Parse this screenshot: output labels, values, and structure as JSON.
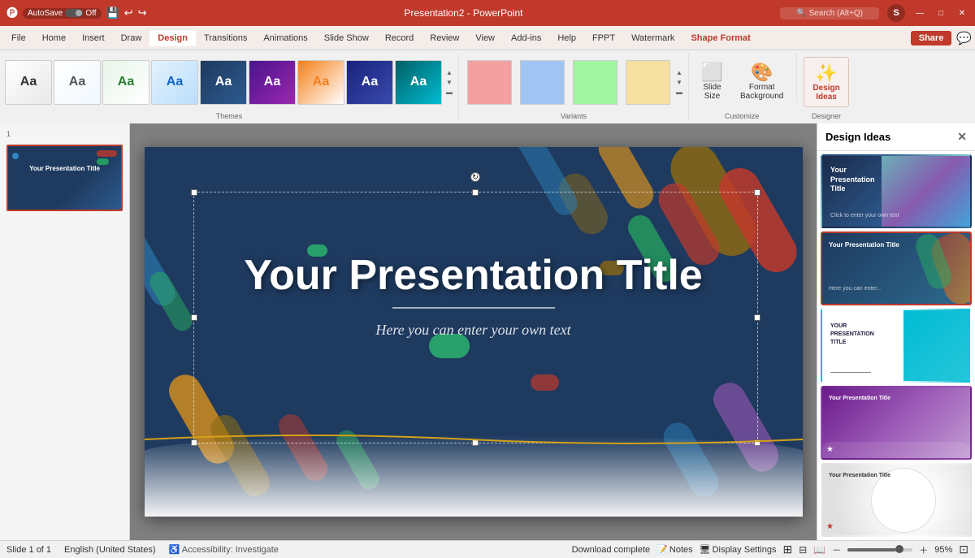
{
  "titlebar": {
    "autosave_label": "AutoSave",
    "autosave_state": "Off",
    "file_name": "Presentation2 - PowerPoint",
    "search_placeholder": "Search (Alt+Q)",
    "user_initials": "S",
    "minimize_label": "—",
    "maximize_label": "□",
    "close_label": "✕"
  },
  "tabs": {
    "items": [
      "File",
      "Home",
      "Insert",
      "Draw",
      "Design",
      "Transitions",
      "Animations",
      "Slide Show",
      "Record",
      "Review",
      "View",
      "Add-ins",
      "Help",
      "FPPT",
      "Watermark",
      "Shape Format"
    ],
    "active": "Design",
    "special": "Shape Format"
  },
  "ribbon": {
    "themes_label": "Themes",
    "variants_label": "Variants",
    "customize_label": "Customize",
    "designer_label": "Designer",
    "slide_size_label": "Slide\nSize",
    "format_background_label": "Format\nBackground",
    "design_ideas_label": "Design\nIdeas",
    "share_label": "Share"
  },
  "themes": [
    {
      "id": "t1",
      "label": "Aa",
      "class": "tc1"
    },
    {
      "id": "t2",
      "label": "Aa",
      "class": "tc2"
    },
    {
      "id": "t3",
      "label": "Aa",
      "class": "tc3"
    },
    {
      "id": "t4",
      "label": "Aa",
      "class": "tc4"
    },
    {
      "id": "t5",
      "label": "Aa",
      "class": "tc5"
    },
    {
      "id": "t6",
      "label": "Aa",
      "class": "tc6"
    },
    {
      "id": "t7",
      "label": "Aa",
      "class": "tc7"
    },
    {
      "id": "t8",
      "label": "Aa",
      "class": "tc8"
    },
    {
      "id": "t9",
      "label": "Aa",
      "class": "tc9"
    }
  ],
  "slide": {
    "number": "1",
    "title": "Your Presentation Title",
    "subtitle": "Here you can enter your own text"
  },
  "design_ideas": {
    "panel_title": "Design Ideas",
    "items": [
      {
        "id": "di1",
        "class": "di-1",
        "title": "Your\nPresentation\nTitle",
        "selected": false
      },
      {
        "id": "di2",
        "class": "di-2",
        "title": "Your Presentation Title",
        "selected": true
      },
      {
        "id": "di3",
        "class": "di-3",
        "title": "YOUR\nPRESENTATION\nTITLE",
        "selected": false
      },
      {
        "id": "di4",
        "class": "di-4",
        "title": "",
        "selected": false
      },
      {
        "id": "di5",
        "class": "di-5",
        "title": "",
        "selected": false
      }
    ]
  },
  "statusbar": {
    "slide_info": "Slide 1 of 1",
    "language": "English (United States)",
    "accessibility": "Accessibility: Investigate",
    "download_status": "Download complete",
    "notes_label": "Notes",
    "display_settings_label": "Display Settings",
    "zoom_level": "95%"
  }
}
